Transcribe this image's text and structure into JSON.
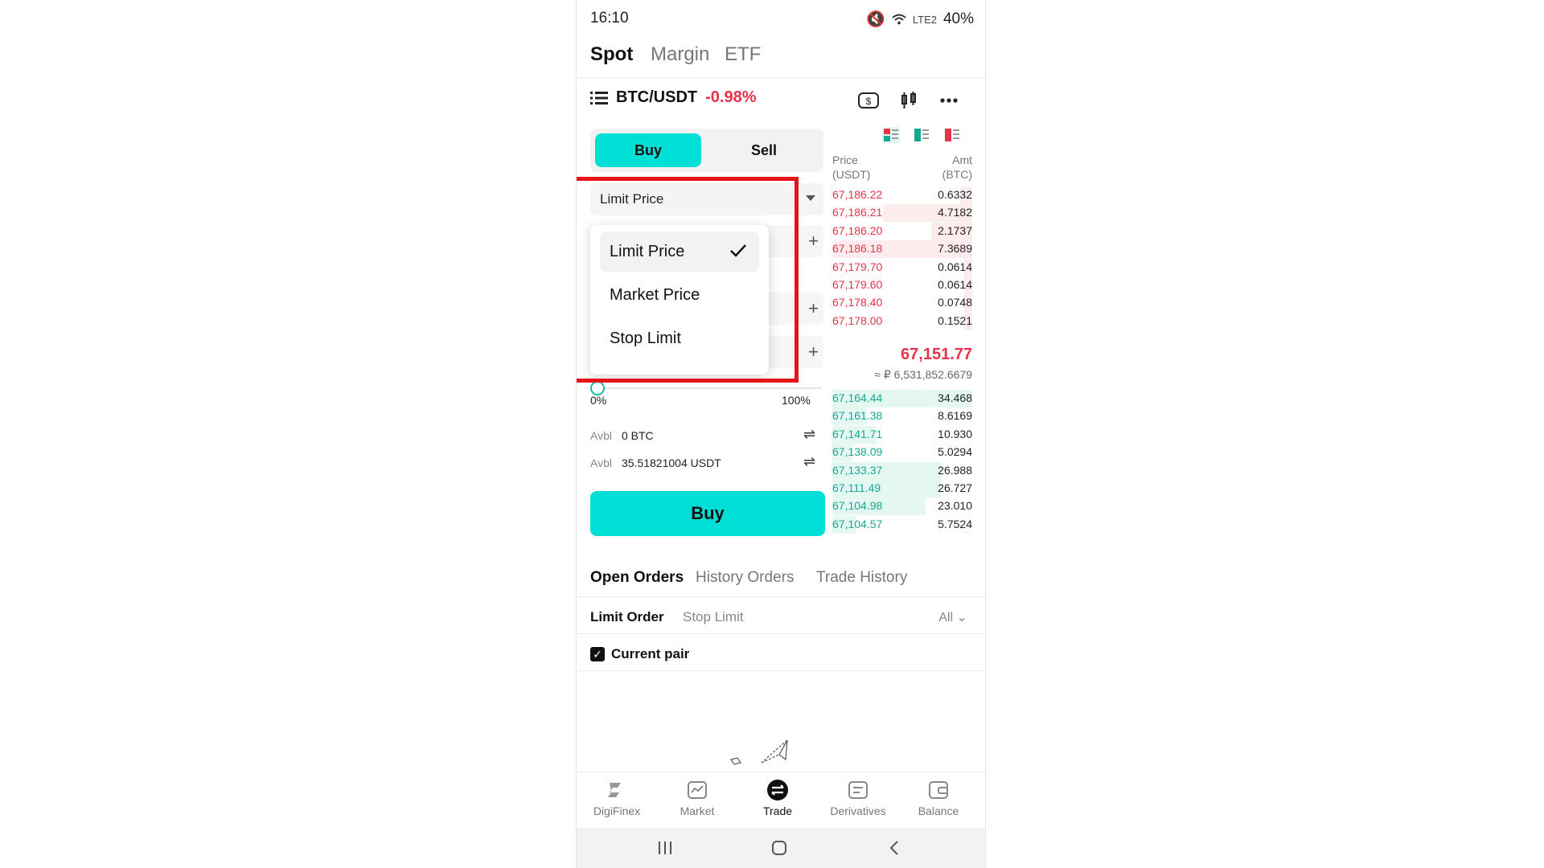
{
  "status": {
    "time": "16:10",
    "battery": "40%",
    "net": "LTE2"
  },
  "market_tabs": [
    "Spot",
    "Margin",
    "ETF"
  ],
  "pair": {
    "name": "BTC/USDT",
    "change": "-0.98%"
  },
  "trade": {
    "buy_tab": "Buy",
    "sell_tab": "Sell",
    "order_type": "Limit Price",
    "dropdown": [
      "Limit Price",
      "Market Price",
      "Stop Limit"
    ],
    "pct_min": "0%",
    "pct_max": "100%",
    "avbl_label": "Avbl",
    "avbl_btc": "0 BTC",
    "avbl_usdt": "35.51821004 USDT",
    "buy_button": "Buy"
  },
  "orderbook": {
    "price_hdr": "Price",
    "price_unit": "(USDT)",
    "amt_hdr": "Amt",
    "amt_unit": "(BTC)",
    "asks": [
      {
        "p": "67,186.22",
        "a": "0.6332"
      },
      {
        "p": "67,186.21",
        "a": "4.7182"
      },
      {
        "p": "67,186.20",
        "a": "2.1737"
      },
      {
        "p": "67,186.18",
        "a": "7.3689"
      },
      {
        "p": "67,179.70",
        "a": "0.0614"
      },
      {
        "p": "67,179.60",
        "a": "0.0614"
      },
      {
        "p": "67,178.40",
        "a": "0.0748"
      },
      {
        "p": "67,178.00",
        "a": "0.1521"
      }
    ],
    "last_price": "67,151.77",
    "last_sub": "≈ ₽ 6,531,852.6679",
    "bids": [
      {
        "p": "67,164.44",
        "a": "34.468"
      },
      {
        "p": "67,161.38",
        "a": "8.6169"
      },
      {
        "p": "67,141.71",
        "a": "10.930"
      },
      {
        "p": "67,138.09",
        "a": "5.0294"
      },
      {
        "p": "67,133.37",
        "a": "26.988"
      },
      {
        "p": "67,111.49",
        "a": "26.727"
      },
      {
        "p": "67,104.98",
        "a": "23.010"
      },
      {
        "p": "67,104.57",
        "a": "5.7524"
      }
    ]
  },
  "orders": {
    "tabs": [
      "Open Orders",
      "History Orders",
      "Trade History"
    ],
    "filters": [
      "Limit Order",
      "Stop Limit"
    ],
    "all": "All",
    "current_pair": "Current pair"
  },
  "nav": [
    "DigiFinex",
    "Market",
    "Trade",
    "Derivatives",
    "Balance"
  ],
  "colors": {
    "accent": "#00dfd5",
    "ask": "#e8324a",
    "bid": "#17a892",
    "highlight": "#e5141b"
  }
}
